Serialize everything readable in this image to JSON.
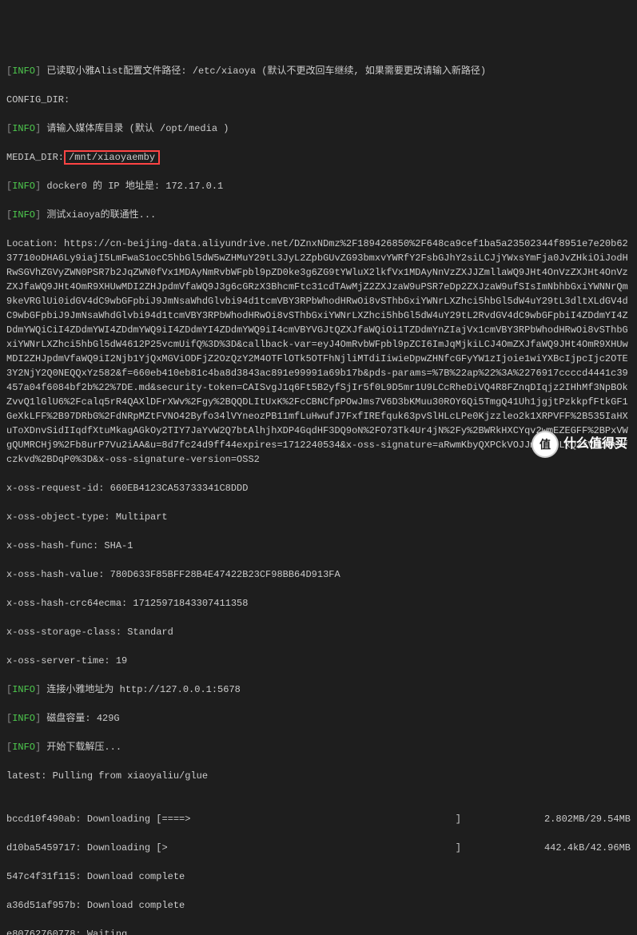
{
  "l0": {
    "tag": "INFO",
    "text": "已读取小雅Alist配置文件路径: /etc/xiaoya (默认不更改回车继续, 如果需要更改请输入新路径)"
  },
  "l1": {
    "text": "CONFIG_DIR:"
  },
  "l2": {
    "tag": "INFO",
    "text": "请输入媒体库目录 (默认 /opt/media )"
  },
  "l3": {
    "label": "MEDIA_DIR:",
    "value": "/mnt/xiaoyaemby"
  },
  "l4": {
    "tag": "INFO",
    "text": "docker0 的 IP 地址是: 172.17.0.1"
  },
  "l5": {
    "tag": "INFO",
    "text": "测试xiaoya的联通性..."
  },
  "loc": "Location: https://cn-beijing-data.aliyundrive.net/DZnxNDmz%2F189426850%2F648ca9cef1ba5a23502344f8951e7e20b6237710oDHA6Ly9iajI5LmFwaS1ocC5hbGl5dW5wZHMuY29tL3JyL2ZpbGUvZG93bmxvYWRfY2FsbGJhY2siLCJjYWxsYmFja0JvZHkiOiJodHRwSGVhZGVyZWN0PSR7b2JqZWN0fVx1MDAyNmRvbWFpbl9pZD0ke3g6ZG9tYWluX2lkfVx1MDAyNnVzZXJJZmllaWQ9JHt4OnVzZXJHt4OnVzZXJfaWQ9JHt4OmR9XHUwMDI2ZHJpdmVfaWQ9J3g6cGRzX3BhcmFtc31cdTAwMjZ2ZXJzaW9uPSR7eDp2ZXJzaW9ufSIsImNbhbGxiYWNNrQm9keVRGlUi0idGV4dC9wbGFpbiJ9JmNsaWhdGlvbi94d1tcmVBY3RPbWhodHRwOi8vSThbGxiYWNrLXZhci5hbGl5dW4uY29tL3dltXLdGV4dC9wbGFpbiJ9JmNsaWhdGlvbi94d1tcmVBY3RPbWhodHRwOi8vSThbGxiYWNrLXZhci5hbGl5dW4uY29tL2RvdGV4dC9wbGFpbiI4ZDdmYI4ZDdmYWQiCiI4ZDdmYWI4ZDdmYWQ9iI4ZDdmYI4ZDdmYWQ9iI4cmVBYVGJtQZXJfaWQiOi1TZDdmYnZIajVx1cmVBY3RPbWhodHRwOi8vSThbGxiYWNrLXZhci5hbGl5dW4612P25vcmUifQ%3D%3D&callback-var=eyJ4OmRvbWFpbl9pZCI6ImJqMjkiLCJ4OmZXJfaWQ9JHt4OmR9XHUwMDI2ZHJpdmVfaWQ9iI2Njb1YjQxMGViODFjZ2OzQzY2M4OTFlOTk5OTFhNjliMTdiIiwieDpwZHNfcGFyYW1zIjoie1wiYXBcIjpcIjc2OTE3Y2NjY2Q0NEQQxYz582&f=660eb410eb81c4ba8d3843ac891e99991a69b17b&pds-params=%7B%22ap%22%3A%2276917ccccd4441c39457a04f6084bf2b%22%7DE.md&security-token=CAISvgJ1q6Ft5B2yfSjIr5f0L9D5mr1U9LCcRheDiVQ4R8FZnqDIqjz2IHhMf3NpBOkZvvQ1lGlU6%2Fcalq5rR4QAXlDFrXWv%2Fgy%2BQQDLItUxK%2FcCBNCfpPOwJms7V6D3bKMuu30ROY6Qi5TmgQ41Uh1jgjtPzkkpfFtkGF1GeXkLFF%2B97DRbG%2FdNRpMZtFVNO42Byfo34lVYneozPB11mfLuHwufJ7FxfIREfquk63pvSlHLcLPe0Kjzzleo2k1XRPVFF%2B535IaHXuToXDnvSidIIqdfXtuMkagAGkOy2TIY7JaYvW2Q7btAlhjhXDP4GqdHF3DQ9oN%2FO73Tk4Ur4jN%2Fy%2BWRkHXCYqv2wmEZEGFF%2BPxVWgQUMRCHj9%2Fb8urP7Vu2iAA&u=8d7fc24d9ff44expires=1712240534&x-oss-signature=aRwmKbyQXPCkVOJJmMAbbLxQZfVMLHk3fczkvd%2BDqP0%3D&x-oss-signature-version=OSS2",
  "h0": "x-oss-request-id: 660EB4123CA53733341C8DDD",
  "h1": "x-oss-object-type: Multipart",
  "h2": "x-oss-hash-func: SHA-1",
  "h3": "x-oss-hash-value: 780D633F85BFF28B4E47422B23CF98BB64D913FA",
  "h4": "x-oss-hash-crc64ecma: 17125971843307411358",
  "h5": "x-oss-storage-class: Standard",
  "h6": "x-oss-server-time: 19",
  "l6": {
    "tag": "INFO",
    "text": "连接小雅地址为 http://127.0.0.1:5678"
  },
  "l7": {
    "tag": "INFO",
    "text": "磁盘容量: 429G"
  },
  "l8": {
    "tag": "INFO",
    "text": "开始下载解压..."
  },
  "pull": "latest: Pulling from xiaoyaliu/glue",
  "d0": {
    "id": "bccd10f490ab",
    "st": "Downloading",
    "bar": "[====>                                              ]",
    "sz": "2.802MB/29.54MB"
  },
  "d1": {
    "id": "d10ba5459717",
    "st": "Downloading",
    "bar": "[>                                                  ]",
    "sz": "442.4kB/42.96MB"
  },
  "d2": {
    "id": "547c4f31f115",
    "st": "Download complete"
  },
  "d3": {
    "id": "a36d51af957b",
    "st": "Download complete"
  },
  "d4": {
    "id": "e80762760778",
    "st": "Waiting"
  },
  "wm": {
    "badge": "值",
    "text": "什么值得买"
  }
}
